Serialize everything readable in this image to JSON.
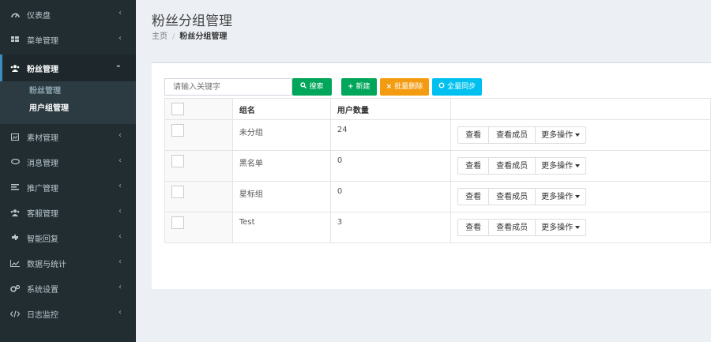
{
  "sidebar": {
    "items": [
      {
        "label": "仪表盘",
        "icon": "dashboard-icon"
      },
      {
        "label": "菜单管理",
        "icon": "grid-icon"
      },
      {
        "label": "粉丝管理",
        "icon": "users-icon",
        "open": true
      },
      {
        "label": "素材管理",
        "icon": "image-icon"
      },
      {
        "label": "消息管理",
        "icon": "chat-icon"
      },
      {
        "label": "推广管理",
        "icon": "list-icon"
      },
      {
        "label": "客服管理",
        "icon": "support-icon"
      },
      {
        "label": "智能回复",
        "icon": "puzzle-icon"
      },
      {
        "label": "数据与统计",
        "icon": "chart-icon"
      },
      {
        "label": "系统设置",
        "icon": "gears-icon"
      },
      {
        "label": "日志监控",
        "icon": "code-icon"
      }
    ],
    "submenu": [
      {
        "label": "粉丝管理"
      },
      {
        "label": "用户组管理",
        "active": true
      }
    ]
  },
  "header": {
    "title": "粉丝分组管理",
    "breadcrumb_home": "主页",
    "breadcrumb_sep": "/",
    "breadcrumb_current": "粉丝分组管理"
  },
  "toolbar": {
    "search_placeholder": "请输入关键字",
    "search_label": "搜索",
    "new_label": "新建",
    "delete_label": "批量删除",
    "sync_label": "全量同步"
  },
  "table": {
    "columns": [
      "组名",
      "用户数量"
    ],
    "rows": [
      {
        "name": "未分组",
        "count": "24"
      },
      {
        "name": "黑名单",
        "count": "0"
      },
      {
        "name": "星标组",
        "count": "0"
      },
      {
        "name": "Test",
        "count": "3"
      }
    ],
    "actions": {
      "view": "查看",
      "members": "查看成员",
      "more": "更多操作"
    }
  },
  "colors": {
    "sidebar_bg": "#222d32",
    "success": "#00a65a",
    "warning": "#f39c12",
    "info": "#00c0ef",
    "primary": "#3c8dbc"
  }
}
